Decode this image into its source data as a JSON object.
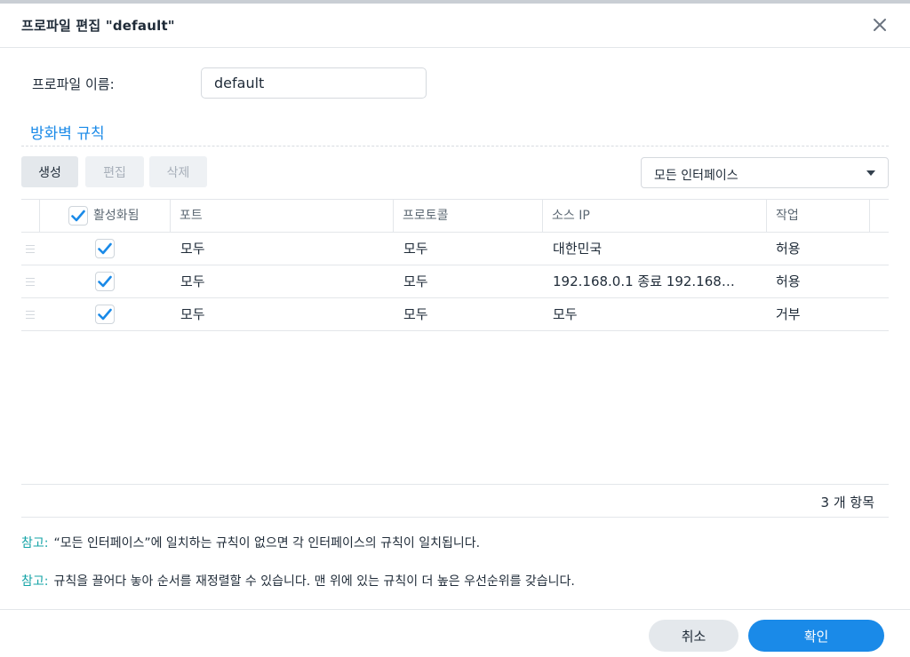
{
  "dialog": {
    "title": "프로파일 편집 \"default\"",
    "close_icon": "close-icon"
  },
  "profile": {
    "name_label": "프로파일 이름:",
    "name_value": "default"
  },
  "section": {
    "title": "방화벽 규칙"
  },
  "toolbar": {
    "create_label": "생성",
    "edit_label": "편집",
    "delete_label": "삭제",
    "interface_selected": "모든 인터페이스"
  },
  "grid": {
    "headers": {
      "enabled": "활성화됨",
      "port": "포트",
      "protocol": "프로토콜",
      "source_ip": "소스 IP",
      "action": "작업"
    },
    "rows": [
      {
        "enabled": true,
        "port": "모두",
        "protocol": "모두",
        "source_ip": "대한민국",
        "action": "허용"
      },
      {
        "enabled": true,
        "port": "모두",
        "protocol": "모두",
        "source_ip": "192.168.0.1 종료 192.168…",
        "action": "허용"
      },
      {
        "enabled": true,
        "port": "모두",
        "protocol": "모두",
        "source_ip": "모두",
        "action": "거부"
      }
    ],
    "count_text": "3 개 항목"
  },
  "notes": [
    {
      "label": "참고:",
      "text": "“모든 인터페이스”에 일치하는 규칙이 없으면 각 인터페이스의 규칙이 일치됩니다."
    },
    {
      "label": "참고:",
      "text": "규칙을 끌어다 놓아 순서를 재정렬할 수 있습니다. 맨 위에 있는 규칙이 더 높은 우선순위를 갖습니다."
    }
  ],
  "footer": {
    "cancel_label": "취소",
    "ok_label": "확인"
  },
  "colors": {
    "accent": "#1a8ae8",
    "note_label": "#13a3a6",
    "checkbox": "#1a8ae8"
  }
}
